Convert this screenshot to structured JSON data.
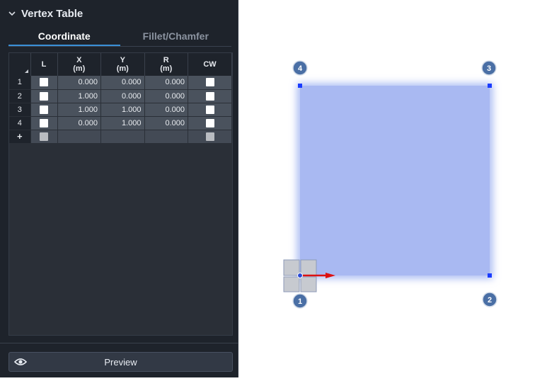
{
  "panel": {
    "title": "Vertex Table",
    "tabs": [
      {
        "label": "Coordinate",
        "active": true
      },
      {
        "label": "Fillet/Chamfer",
        "active": false
      }
    ]
  },
  "table": {
    "headers": {
      "l": "L",
      "x": "X",
      "x_unit": "(m)",
      "y": "Y",
      "y_unit": "(m)",
      "r": "R",
      "r_unit": "(m)",
      "cw": "CW"
    },
    "rows": [
      {
        "index": "1",
        "x": "0.000",
        "y": "0.000",
        "r": "0.000"
      },
      {
        "index": "2",
        "x": "1.000",
        "y": "0.000",
        "r": "0.000"
      },
      {
        "index": "3",
        "x": "1.000",
        "y": "1.000",
        "r": "0.000"
      },
      {
        "index": "4",
        "x": "0.000",
        "y": "1.000",
        "r": "0.000"
      }
    ],
    "new_row_symbol": "+"
  },
  "footer": {
    "preview_label": "Preview",
    "preview_icon": "eye-icon"
  },
  "viewport": {
    "vertex_labels": [
      "1",
      "2",
      "3",
      "4"
    ],
    "fill_color": "#a9b9f2",
    "marker_color": "#4a6fa5",
    "handle_color": "#1a3cff",
    "axis_x_color": "#dd1111"
  }
}
